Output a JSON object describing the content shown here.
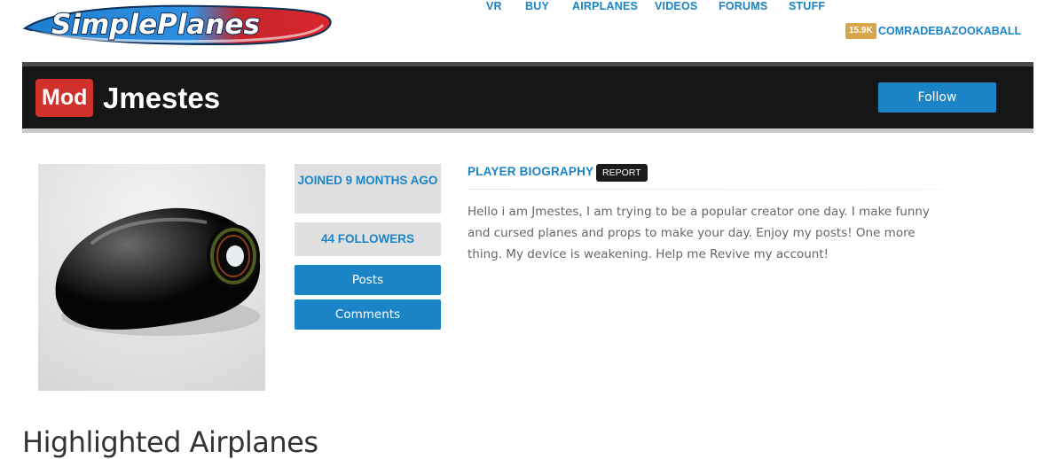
{
  "header": {
    "logo_text": "SimplePlanes",
    "nav": [
      "VR",
      "BUY",
      "AIRPLANES",
      "VIDEOS",
      "FORUMS",
      "STUFF"
    ],
    "user_points": "15.9K",
    "username": "COMRADEBAZOOKABALL"
  },
  "profile": {
    "role_badge": "Mod",
    "name": "Jmestes",
    "follow_label": "Follow",
    "joined": "JOINED 9 MONTHS AGO",
    "followers": "44 FOLLOWERS",
    "posts_label": "Posts",
    "comments_label": "Comments"
  },
  "biography": {
    "heading": "PLAYER BIOGRAPHY",
    "report_label": "REPORT",
    "text": "Hello i am Jmestes, I am trying to be a popular creator one day. I make funny and cursed planes and props to make your day. Enjoy my posts! One more thing. My device is weakening. Help me Revive my account!"
  },
  "sections": {
    "highlighted_title": "Highlighted Airplanes"
  },
  "colors": {
    "link_blue": "#1a84c7",
    "mod_red": "#d0312d",
    "banner_dark": "#161616",
    "points_gold": "#d8a64a"
  }
}
